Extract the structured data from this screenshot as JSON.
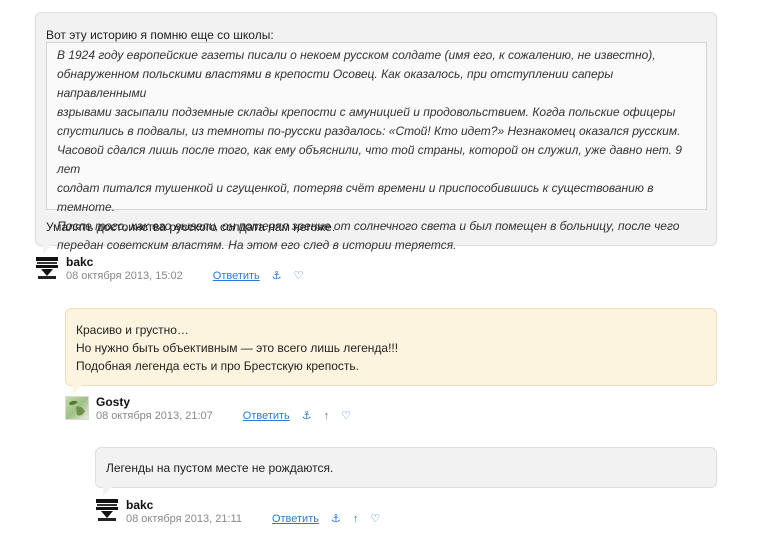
{
  "comments": [
    {
      "intro": "Вот эту историю я помню еще со школы:",
      "quote": [
        "В 1924 году европейские газеты писали о некоем русском солдате (имя его, к сожалению, не известно),",
        "обнаруженном польскими властями в крепости Осовец. Как оказалось, при отступлении саперы направленными",
        "взрывами засыпали подземные склады крепости с амуницией и продовольствием. Когда польские офицеры",
        "спустились в подвалы, из темноты по-русски раздалось: «Стой! Кто идет?» Незнакомец оказался русским.",
        "Часовой сдался лишь после того, как ему объяснили, что той страны, которой он служил, уже давно нет. 9 лет",
        "солдат питался тушенкой и сгущенкой, потеряв счёт времени и приспособившись к существованию в темноте.",
        "После того, как его вывели, он потерял зрение от солнечного света и был помещен в больницу, после чего",
        "передан советским властям. На этом его след в истории теряется."
      ],
      "outro": "Умалять достоинства русского солдата нам негоже.",
      "author": "bakc",
      "date": "08 октября 2013, 15:02",
      "reply_label": "Ответить",
      "icons": [
        "anchor-icon",
        "heart-icon"
      ]
    },
    {
      "lines": [
        "Красиво и грустно…",
        "Но нужно быть объективным — это всего лишь легенда!!!",
        "Подобная легенда есть и про Брестскую крепость."
      ],
      "author": "Gosty",
      "date": "08 октября 2013, 21:07",
      "reply_label": "Ответить",
      "icons": [
        "anchor-icon",
        "arrow-up-icon",
        "heart-icon"
      ]
    },
    {
      "lines": [
        "Легенды на пустом месте не рождаются."
      ],
      "author": "bakc",
      "date": "08 октября 2013, 21:11",
      "reply_label": "Ответить",
      "icons": [
        "anchor-icon",
        "arrow-up-icon",
        "heart-icon"
      ]
    }
  ],
  "glyphs": {
    "anchor": "⚓",
    "up": "↑",
    "heart": "♡"
  }
}
